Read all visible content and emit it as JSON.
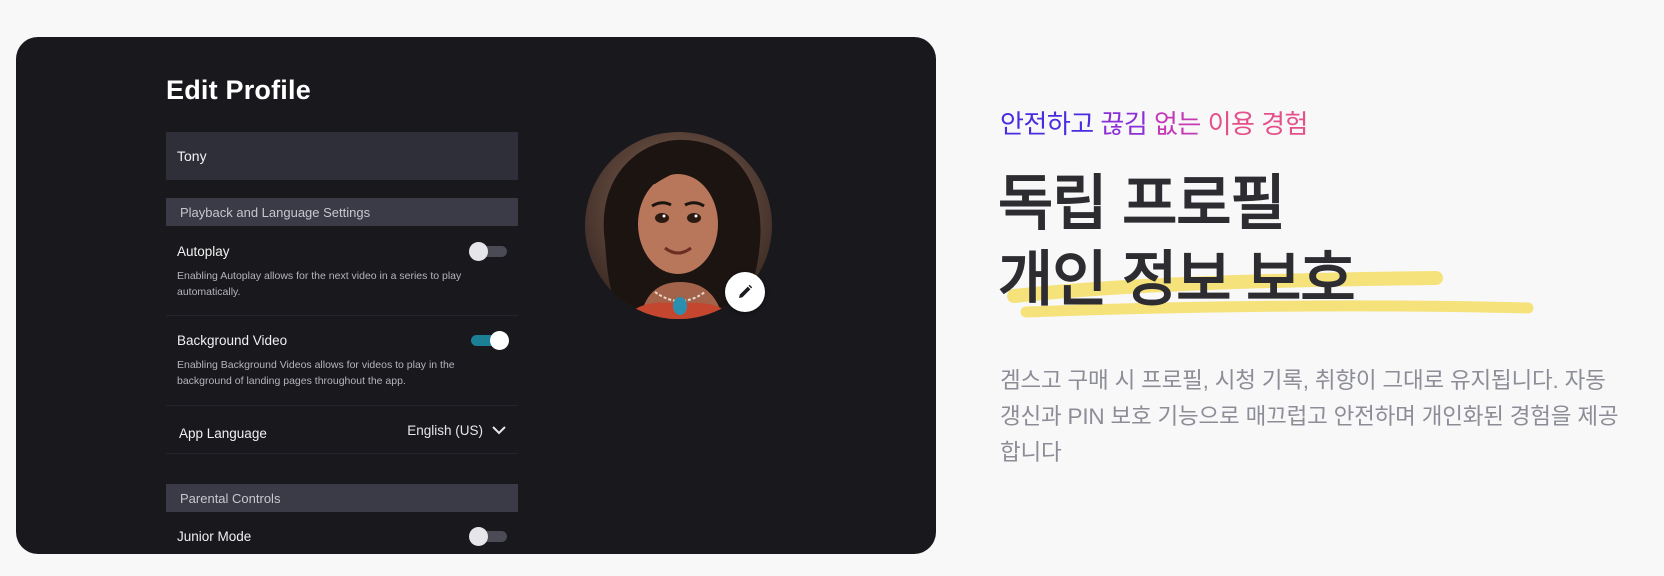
{
  "profile_editor": {
    "title": "Edit Profile",
    "profile_name": "Tony",
    "sections": {
      "playback": "Playback and Language Settings",
      "parental": "Parental Controls"
    },
    "settings": {
      "autoplay": {
        "label": "Autoplay",
        "description": "Enabling Autoplay allows for the next video in a series to play automatically.",
        "enabled": false
      },
      "background_video": {
        "label": "Background Video",
        "description": "Enabling Background Videos allows for videos to play in the background of landing pages throughout the app.",
        "enabled": true
      },
      "app_language": {
        "label": "App Language",
        "value": "English (US)"
      },
      "junior_mode": {
        "label": "Junior Mode",
        "enabled": false
      }
    },
    "icons": {
      "edit": "pencil-icon",
      "dropdown": "chevron-down-icon"
    },
    "colors": {
      "toggle_on": "#1c7f96",
      "panel_bg": "#18181d"
    }
  },
  "promo": {
    "eyebrow": {
      "part1": "안전하고",
      "part2": "끊김",
      "part3": "없는",
      "part4": "이용 경험"
    },
    "headline_line1": "독립 프로필",
    "headline_line2": "개인 정보 보호",
    "body": "겜스고 구매 시 프로필, 시청 기록, 취향이 그대로 유지됩니다. 자동 갱신과 PIN 보호 기능으로 매끄럽고 안전하며 개인화된 경험을 제공합니다",
    "colors": {
      "eyebrow_gradient": [
        "#4a2be0",
        "#8b2fd6",
        "#c43ab6",
        "#e4508a"
      ],
      "highlight": "#f6e27a",
      "headline": "#2c2c31",
      "body": "#8c8d96"
    }
  }
}
